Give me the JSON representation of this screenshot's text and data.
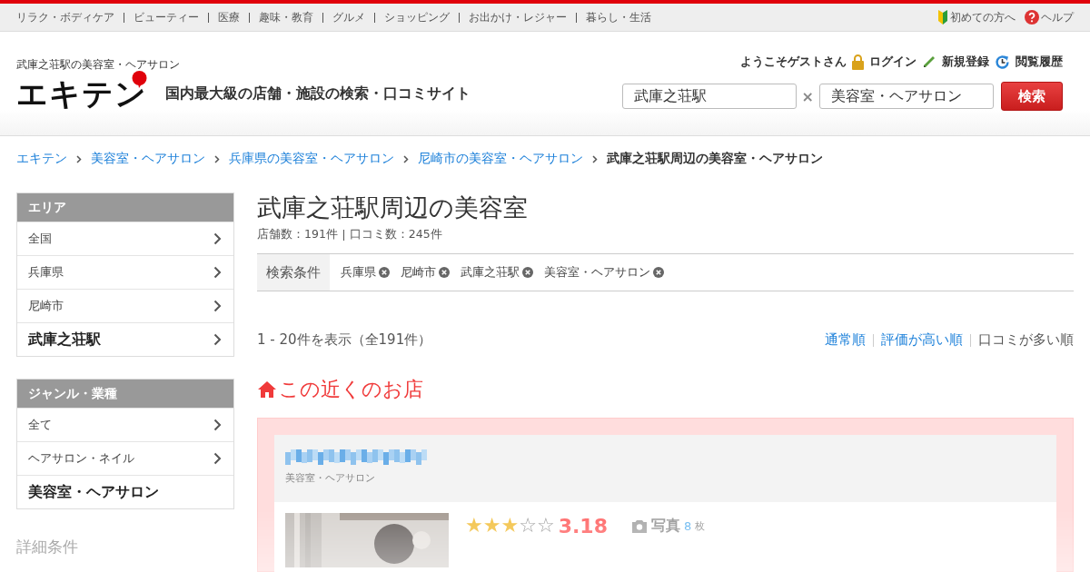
{
  "top_nav": {
    "links": [
      "リラク・ボディケア",
      "ビューティー",
      "医療",
      "趣味・教育",
      "グルメ",
      "ショッピング",
      "お出かけ・レジャー",
      "暮らし・生活"
    ],
    "guide_link": "初めての方へ",
    "help_link": "ヘルプ"
  },
  "header": {
    "tagline": "武庫之荘駅の美容室・ヘアサロン",
    "logo": "エキテン",
    "catchphrase": "国内最大級の店舗・施設の検索・口コミサイト",
    "welcome": "ようこそゲストさん",
    "login": "ログイン",
    "register": "新規登録",
    "history": "閲覧履歴",
    "area_field": {
      "value": "武庫之荘駅"
    },
    "separator": "×",
    "genre_field": {
      "value": "美容室・ヘアサロン"
    },
    "search_button": "検索"
  },
  "breadcrumbs": [
    {
      "label": "エキテン",
      "current": false
    },
    {
      "label": "美容室・ヘアサロン",
      "current": false
    },
    {
      "label": "兵庫県の美容室・ヘアサロン",
      "current": false
    },
    {
      "label": "尼崎市の美容室・ヘアサロン",
      "current": false
    },
    {
      "label": "武庫之荘駅周辺の美容室・ヘアサロン",
      "current": true
    }
  ],
  "sidebar": {
    "sections": [
      {
        "heading": "エリア",
        "items": [
          {
            "label": "全国",
            "selected": false
          },
          {
            "label": "兵庫県",
            "selected": false
          },
          {
            "label": "尼崎市",
            "selected": false
          },
          {
            "label": "武庫之荘駅",
            "selected": true
          }
        ]
      },
      {
        "heading": "ジャンル・業種",
        "items": [
          {
            "label": "全て",
            "selected": false
          },
          {
            "label": "ヘアサロン・ネイル",
            "selected": false
          },
          {
            "label": "美容室・ヘアサロン",
            "selected": true
          }
        ]
      }
    ],
    "detail_heading": "詳細条件"
  },
  "main": {
    "title": "武庫之荘駅周辺の美容室",
    "stats": [
      "店舗数：191件",
      "口コミ数：245件"
    ],
    "filter": {
      "label": "検索条件",
      "chips": [
        "兵庫県",
        "尼崎市",
        "武庫之荘駅",
        "美容室・ヘアサロン"
      ]
    },
    "result_count": "1 - 20件を表示（全191件）",
    "sort_options": [
      {
        "label": "通常順",
        "selected": false
      },
      {
        "label": "評価が高い順",
        "selected": false
      },
      {
        "label": "口コミが多い順",
        "selected": true
      }
    ],
    "nearby_heading": "この近くのお店",
    "shop": {
      "category": "美容室・ヘアサロン",
      "stars": 3,
      "rating": "3.18",
      "photo_label": "写真",
      "photo_count": "8",
      "photo_unit": "枚"
    }
  }
}
